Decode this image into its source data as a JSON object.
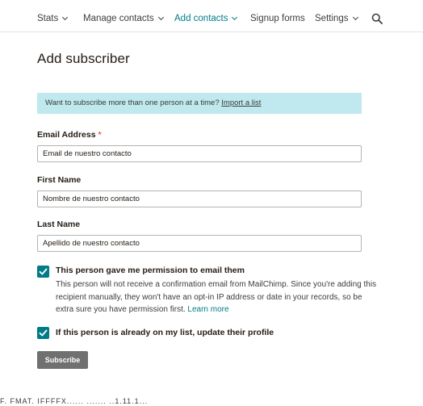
{
  "nav": {
    "items": [
      {
        "label": "Stats"
      },
      {
        "label": "Manage contacts"
      },
      {
        "label": "Add contacts"
      },
      {
        "label": "Signup forms"
      },
      {
        "label": "Settings"
      }
    ],
    "active": "Add contacts",
    "search_icon": "search-icon"
  },
  "page": {
    "title": "Add subscriber"
  },
  "banner": {
    "text": "Want to subscribe more than one person at a time?",
    "link": "Import a list"
  },
  "form": {
    "email": {
      "label": "Email Address",
      "required_mark": "*",
      "value": "Email de nuestro contacto"
    },
    "first_name": {
      "label": "First Name",
      "value": "Nombre de nuestro contacto"
    },
    "last_name": {
      "label": "Last Name",
      "value": "Apellido de nuestro contacto"
    },
    "permission": {
      "checked": true,
      "label": "This person gave me permission to email them",
      "description": "This person will not receive a confirmation email from MailChimp. Since you're adding this recipient manually, they won't have an opt-in IP address or date in your records, so be extra sure you have permission first.",
      "learn_more": "Learn more"
    },
    "update_profile": {
      "checked": true,
      "label": "If this person is already on my list, update their profile"
    },
    "submit_label": "Subscribe"
  },
  "footer_cut_text": "F. FMAT. IFFFFX...... ....... ..1.11.1...",
  "colors": {
    "accent": "#007c89",
    "banner": "#bfe9ee",
    "button": "#707070",
    "required": "#e85c41"
  }
}
